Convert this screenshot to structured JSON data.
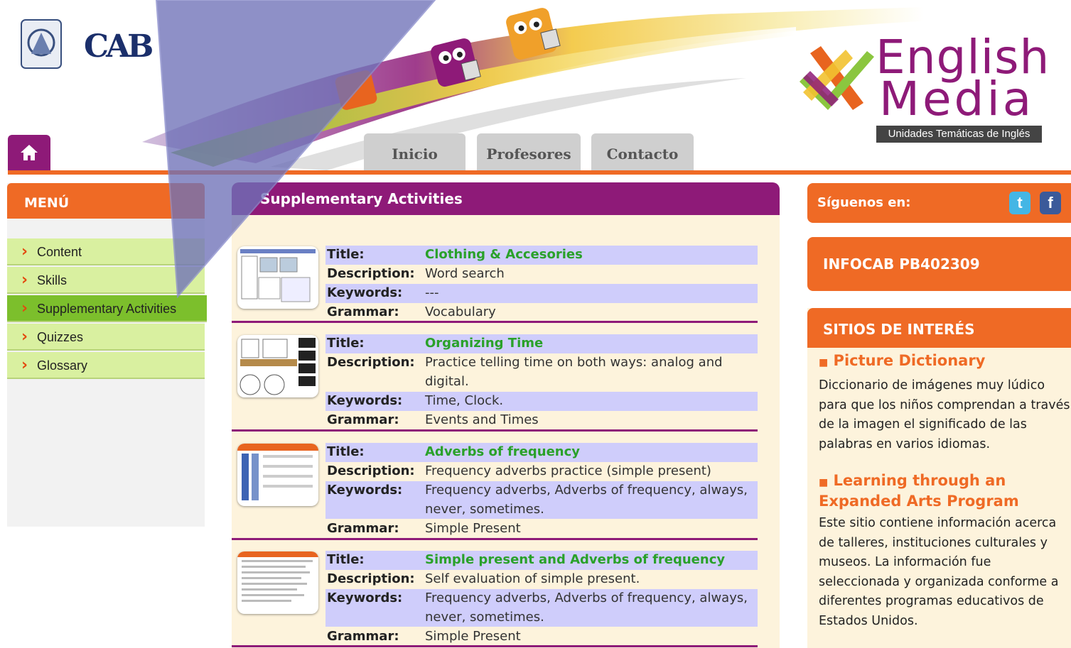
{
  "header": {
    "cab_logo": "CAB",
    "brand_line1": "English",
    "brand_line2": "Media",
    "brand_tagline": "Unidades Temáticas de Inglés",
    "nav_tabs": [
      {
        "label": "Inicio"
      },
      {
        "label": "Profesores"
      },
      {
        "label": "Contacto"
      }
    ]
  },
  "menu": {
    "title": "MENÚ",
    "items": [
      {
        "label": "Content",
        "active": false
      },
      {
        "label": "Skills",
        "active": false
      },
      {
        "label": "Supplementary Activities",
        "active": true
      },
      {
        "label": "Quizzes",
        "active": false
      },
      {
        "label": "Glossary",
        "active": false
      }
    ]
  },
  "main": {
    "title": "Supplementary Activities",
    "labels": {
      "title": "Title:",
      "description": "Description:",
      "keywords": "Keywords:",
      "grammar": "Grammar:"
    },
    "activities": [
      {
        "title": "Clothing & Accesories",
        "description": "Word search",
        "keywords": "---",
        "grammar": "Vocabulary"
      },
      {
        "title": "Organizing Time",
        "description": "Practice telling time on both ways: analog and digital.",
        "keywords": "Time, Clock.",
        "grammar": "Events and Times"
      },
      {
        "title": "Adverbs of frequency",
        "description": "Frequency adverbs practice (simple present)",
        "keywords": "Frequency adverbs, Adverbs of frequency, always, never, sometimes.",
        "grammar": "Simple Present"
      },
      {
        "title": "Simple present and Adverbs of frequency",
        "description": "Self evaluation of simple present.",
        "keywords": "Frequency adverbs, Adverbs of frequency, always, never, sometimes.",
        "grammar": "Simple Present"
      }
    ]
  },
  "sidebar": {
    "follow_label": "Síguenos en:",
    "infocab": "INFOCAB PB402309",
    "sites_title": "SITIOS DE INTERÉS",
    "sites": [
      {
        "title": "Picture Dictionary",
        "description": "Diccionario de imágenes muy lúdico para que los niños comprendan a través de la imagen el significado de las palabras en varios idiomas."
      },
      {
        "title": "Learning through an Expanded Arts Program",
        "description": "Este sitio contiene información acerca de talleres, instituciones culturales y museos. La información fue seleccionada y organizada conforme a diferentes programas educativos de Estados Unidos."
      }
    ]
  },
  "colors": {
    "purple": "#8e1a78",
    "orange": "#ef6a25",
    "menu_green": "#d9f0a0",
    "menu_active": "#7cbf2c",
    "title_green": "#2aa12a",
    "row_highlight": "#cfcdfb",
    "panel_cream": "#fdf3dc"
  },
  "icons": {
    "home": "home-icon",
    "chevron": "chevron-right-icon",
    "twitter": "twitter-icon",
    "facebook": "facebook-icon"
  }
}
